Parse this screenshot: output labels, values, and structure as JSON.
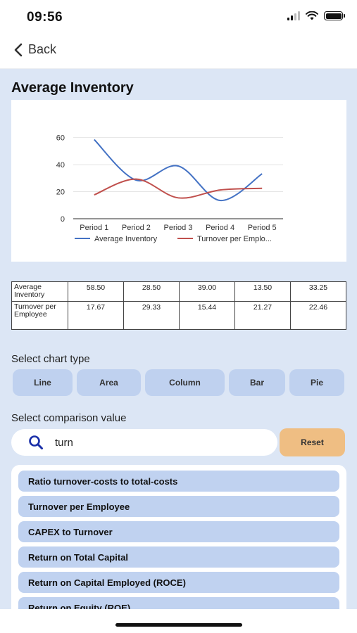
{
  "status": {
    "time": "09:56"
  },
  "nav": {
    "back_label": "Back"
  },
  "page": {
    "title": "Average Inventory"
  },
  "chart_data": {
    "type": "line",
    "categories": [
      "Period 1",
      "Period 2",
      "Period 3",
      "Period 4",
      "Period 5"
    ],
    "series": [
      {
        "name": "Average Inventory",
        "values": [
          58.5,
          28.5,
          39.0,
          13.5,
          33.25
        ],
        "color": "#4472c4"
      },
      {
        "name": "Turnover per Emplo...",
        "values": [
          17.67,
          29.33,
          15.44,
          21.27,
          22.46
        ],
        "color": "#c0504d"
      }
    ],
    "yticks": [
      "60",
      "40",
      "20",
      "0"
    ],
    "ylim": [
      0,
      65
    ],
    "grid": true,
    "legend": "bottom",
    "smooth": true
  },
  "table": {
    "rows": [
      {
        "label": "Average Inventory",
        "values": [
          "58.50",
          "28.50",
          "39.00",
          "13.50",
          "33.25"
        ]
      },
      {
        "label": "Turnover per Employee",
        "values": [
          "17.67",
          "29.33",
          "15.44",
          "21.27",
          "22.46"
        ]
      }
    ]
  },
  "chart_type": {
    "label": "Select chart type",
    "options": [
      "Line",
      "Area",
      "Column",
      "Bar",
      "Pie"
    ]
  },
  "comparison": {
    "label": "Select comparison value",
    "search_value": "turn",
    "reset_label": "Reset",
    "items": [
      "Ratio turnover-costs to total-costs",
      "Turnover per Employee",
      "CAPEX to Turnover",
      "Return on Total Capital",
      "Return on Capital Employed (ROCE)",
      "Return on Equity (ROE)"
    ]
  },
  "colors": {
    "background": "#dce6f5",
    "chip": "#bfd1ef",
    "reset": "#efbe83",
    "search_icon": "#1a2fa8"
  }
}
